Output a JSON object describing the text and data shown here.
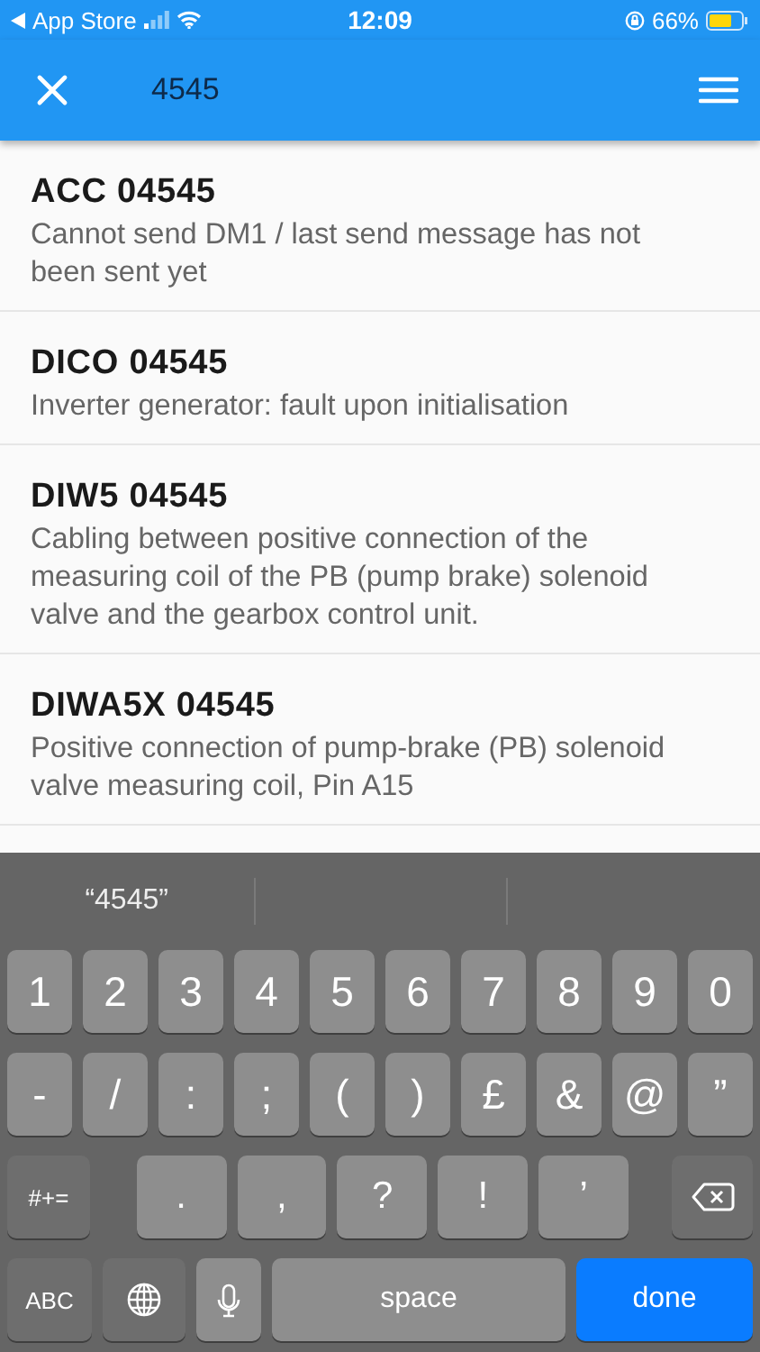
{
  "status_bar": {
    "back_label": "App Store",
    "time": "12:09",
    "battery": "66%"
  },
  "app_bar": {
    "search": {
      "value": "4545"
    }
  },
  "results": [
    {
      "title": "ACC 04545",
      "description": "Cannot send DM1 / last send message has not been sent yet"
    },
    {
      "title": "DICO 04545",
      "description": "Inverter generator: fault upon initialisation"
    },
    {
      "title": "DIW5 04545",
      "description": "Cabling between positive connection of the measuring coil of the PB (pump brake) solenoid valve and the gearbox control unit."
    },
    {
      "title": "DIWA5X 04545",
      "description": "Positive connection of pump-brake (PB) solenoid valve measuring coil, Pin A15"
    }
  ],
  "keyboard": {
    "suggestions": [
      "“4545”"
    ],
    "rows": [
      {
        "keys": [
          {
            "kind": "char",
            "label": "1"
          },
          {
            "kind": "char",
            "label": "2"
          },
          {
            "kind": "char",
            "label": "3"
          },
          {
            "kind": "char",
            "label": "4"
          },
          {
            "kind": "char",
            "label": "5"
          },
          {
            "kind": "char",
            "label": "6"
          },
          {
            "kind": "char",
            "label": "7"
          },
          {
            "kind": "char",
            "label": "8"
          },
          {
            "kind": "char",
            "label": "9"
          },
          {
            "kind": "char",
            "label": "0"
          }
        ]
      },
      {
        "keys": [
          {
            "kind": "char",
            "label": "-"
          },
          {
            "kind": "char",
            "label": "/"
          },
          {
            "kind": "char",
            "label": ":"
          },
          {
            "kind": "char",
            "label": ";"
          },
          {
            "kind": "char",
            "label": "("
          },
          {
            "kind": "char",
            "label": ")"
          },
          {
            "kind": "char",
            "label": "£"
          },
          {
            "kind": "char",
            "label": "&"
          },
          {
            "kind": "char",
            "label": "@"
          },
          {
            "kind": "char",
            "label": "”"
          }
        ]
      },
      {
        "keys": [
          {
            "kind": "mod",
            "label": "#+="
          },
          {
            "kind": "wide",
            "label": "."
          },
          {
            "kind": "wide",
            "label": ","
          },
          {
            "kind": "wide",
            "label": "?"
          },
          {
            "kind": "wide",
            "label": "!"
          },
          {
            "kind": "wide",
            "label": "’"
          },
          {
            "kind": "delete"
          }
        ]
      },
      {
        "keys": [
          {
            "kind": "mod",
            "label": "ABC"
          },
          {
            "kind": "globe"
          },
          {
            "kind": "mic"
          },
          {
            "kind": "space",
            "label": "space"
          },
          {
            "kind": "done",
            "label": "done"
          }
        ]
      }
    ]
  }
}
